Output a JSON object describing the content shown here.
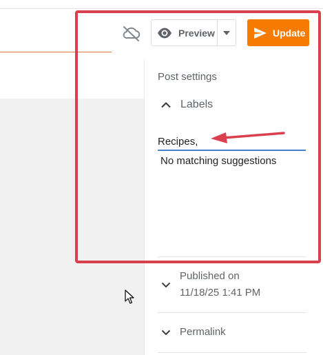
{
  "toolbar": {
    "sync_icon": "cloud-off-icon",
    "preview_icon": "eye-icon",
    "preview_label": "Preview",
    "preview_dropdown_icon": "caret-down-icon",
    "update_icon": "send-icon",
    "update_label": "Update",
    "update_color": "#f57c00"
  },
  "sidebar": {
    "heading": "Post settings",
    "labels": {
      "title": "Labels",
      "toggle_icon": "chevron-up-icon",
      "input_value": "Recipes,",
      "suggestion_text": "No matching suggestions"
    },
    "published": {
      "label": "Published on",
      "date": "11/18/25 1:41 PM",
      "toggle_icon": "chevron-down-icon"
    },
    "permalink": {
      "label": "Permalink",
      "toggle_icon": "chevron-down-icon"
    }
  },
  "annotation": {
    "box_color": "#d8404e",
    "arrow_color": "#d8404e"
  }
}
